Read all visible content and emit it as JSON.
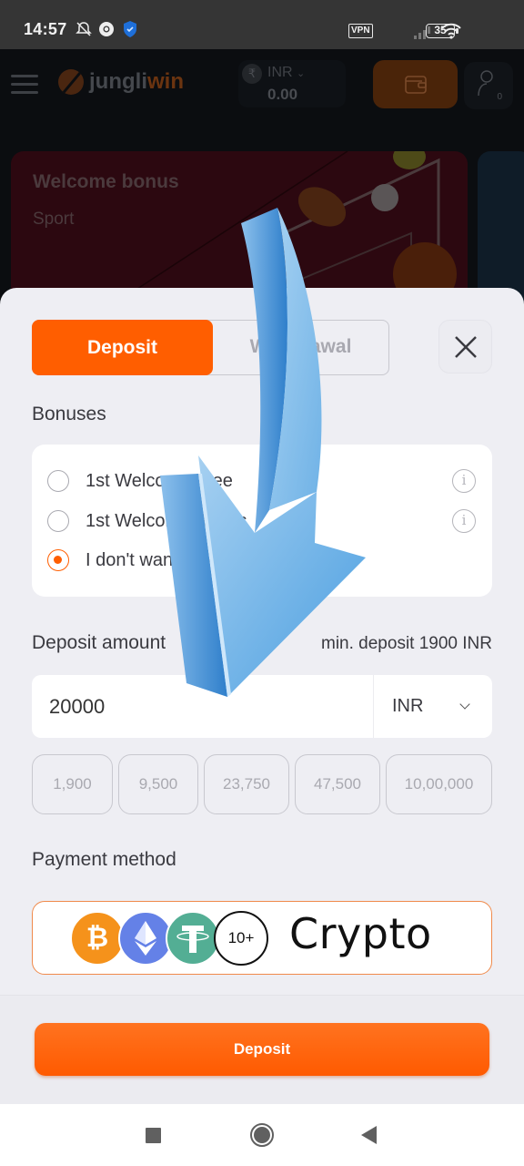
{
  "status_bar": {
    "time": "14:57",
    "left_icons": [
      "bell-off-icon",
      "chrome-icon",
      "shield-vpn-icon"
    ],
    "vpn_label": "VPN",
    "battery": "35",
    "right_icons": [
      "signal-icon",
      "wifi-icon",
      "battery-icon"
    ]
  },
  "header": {
    "logo_text_a": "jungli",
    "logo_text_b": "win",
    "balance_currency": "INR",
    "balance_amount": "0.00",
    "profile_count": "0"
  },
  "banner": {
    "title": "Welcome bonus",
    "subtitle": "Sport"
  },
  "sheet": {
    "tabs": [
      {
        "label": "Deposit",
        "active": true
      },
      {
        "label": "Withdrawal",
        "active": false
      }
    ],
    "bonuses_label": "Bonuses",
    "bonuses": [
      {
        "label": "1st Welcome Free",
        "selected": false,
        "has_info": true
      },
      {
        "label": "1st Welcome Bonus",
        "selected": false,
        "has_info": true
      },
      {
        "label": "I don't want any bonuses",
        "selected": true,
        "has_info": false
      }
    ],
    "deposit_amount_label": "Deposit amount",
    "min_deposit": "min. deposit 1900 INR",
    "amount_value": "20000",
    "currency": "INR",
    "presets": [
      "1,900",
      "9,500",
      "23,750",
      "47,500",
      "10,00,000"
    ],
    "payment_method_label": "Payment method",
    "crypto": {
      "count_badge": "10+",
      "label": "Crypto",
      "coins": [
        "bitcoin",
        "ethereum",
        "tether"
      ]
    },
    "deposit_button": "Deposit"
  },
  "colors": {
    "accent": "#ff5e00",
    "sheet_bg": "#eeeef3",
    "arrow_blue": "#4a9ee0"
  }
}
